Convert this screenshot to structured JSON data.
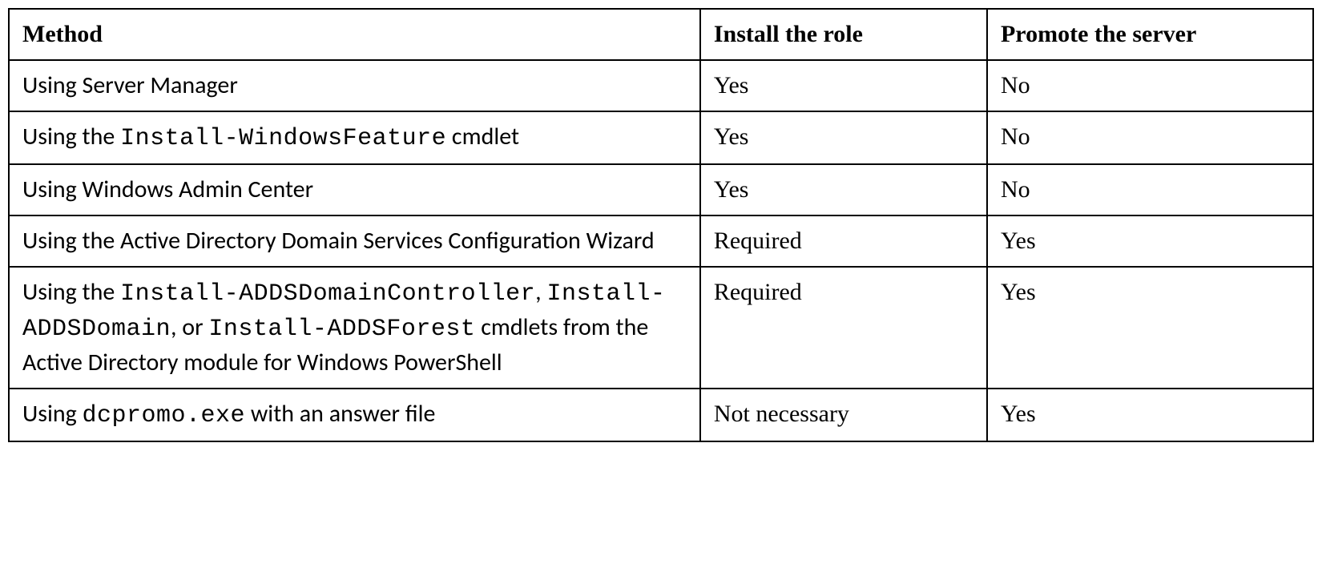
{
  "table": {
    "headers": {
      "method": "Method",
      "install": "Install the role",
      "promote": "Promote the server"
    },
    "rows": [
      {
        "method_parts": [
          {
            "type": "text",
            "content": "Using Server Manager"
          }
        ],
        "install": "Yes",
        "promote": "No"
      },
      {
        "method_parts": [
          {
            "type": "text",
            "content": "Using the "
          },
          {
            "type": "code",
            "content": "Install-WindowsFeature"
          },
          {
            "type": "text",
            "content": " cmdlet"
          }
        ],
        "install": "Yes",
        "promote": "No"
      },
      {
        "method_parts": [
          {
            "type": "text",
            "content": "Using Windows Admin Center"
          }
        ],
        "install": "Yes",
        "promote": "No"
      },
      {
        "method_parts": [
          {
            "type": "text",
            "content": "Using the Active Directory Domain Services Configuration Wizard"
          }
        ],
        "install": "Required",
        "promote": "Yes"
      },
      {
        "method_parts": [
          {
            "type": "text",
            "content": "Using the "
          },
          {
            "type": "code",
            "content": "Install-ADDSDomainController"
          },
          {
            "type": "text",
            "content": ", "
          },
          {
            "type": "code",
            "content": "Install-ADDSDomain"
          },
          {
            "type": "text",
            "content": ", or "
          },
          {
            "type": "code",
            "content": "Install-ADDSForest"
          },
          {
            "type": "text",
            "content": " cmdlets from the Active Directory module for Windows PowerShell"
          }
        ],
        "install": "Required",
        "promote": "Yes"
      },
      {
        "method_parts": [
          {
            "type": "text",
            "content": "Using "
          },
          {
            "type": "code",
            "content": "dcpromo.exe"
          },
          {
            "type": "text",
            "content": " with an answer file"
          }
        ],
        "install": "Not necessary",
        "promote": "Yes"
      }
    ]
  }
}
